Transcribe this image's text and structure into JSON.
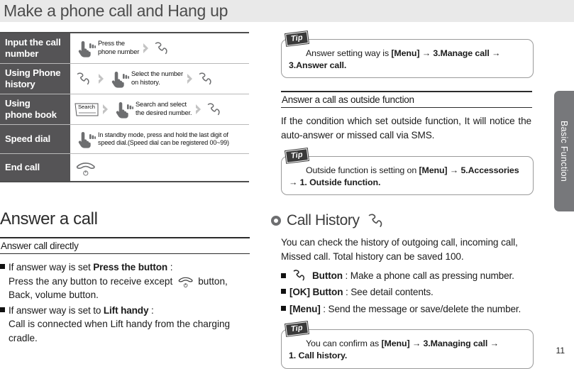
{
  "header": {
    "title": "Make a phone call and Hang up"
  },
  "side_tab": {
    "label": "Basic Function",
    "color": "#77787b"
  },
  "page_number": "11",
  "table": {
    "rows": [
      {
        "label": "Input the call number",
        "steps": [
          {
            "icon": "hand-press-icon"
          },
          {
            "text": "Press the\nphone number"
          },
          {
            "icon": "chevron-right-icon"
          },
          {
            "icon": "handset-icon"
          }
        ]
      },
      {
        "label": "Using Phone history",
        "steps": [
          {
            "icon": "handset-icon"
          },
          {
            "icon": "chevron-right-icon"
          },
          {
            "icon": "hand-press-icon"
          },
          {
            "text": "Select the number\non history."
          },
          {
            "icon": "chevron-right-icon"
          },
          {
            "icon": "handset-icon"
          }
        ]
      },
      {
        "label": "Using\nphone book",
        "steps": [
          {
            "icon": "search-key-icon",
            "icon_label": "Search"
          },
          {
            "icon": "chevron-right-icon"
          },
          {
            "icon": "hand-press-icon"
          },
          {
            "text": "Search and select\nthe desired number."
          },
          {
            "icon": "chevron-right-icon"
          },
          {
            "icon": "handset-icon"
          }
        ]
      },
      {
        "label": "Speed dial",
        "steps": [
          {
            "icon": "hand-press-icon"
          },
          {
            "text": "In standby mode, press and hold the last digit of\nspeed dial.(Speed dial can be registered 00~99)"
          }
        ]
      },
      {
        "label": "End call",
        "steps": [
          {
            "icon": "end-call-icon"
          }
        ]
      }
    ]
  },
  "left": {
    "section_title": "Answer a call",
    "subsection_title": "Answer call directly",
    "bullets": [
      {
        "lead_plain": "If answer way is set ",
        "lead_bold": "Press the button",
        "lead_tail": " :",
        "body_pre": "Press the any button to receive except ",
        "body_icon": "end-call-icon",
        "body_post": " button,",
        "body_line2": "Back, volume button."
      },
      {
        "lead_plain": "If answer way is set to ",
        "lead_bold": "Lift handy",
        "lead_tail": " :",
        "body_line1": "Call is connected when Lift handy from the charging",
        "body_line2": "cradle."
      }
    ]
  },
  "right": {
    "tip1": {
      "badge": "Tip",
      "plain1": "Answer setting way is ",
      "bold1": "[Menu]",
      "arrow1": " → ",
      "bold2": "3.Manage call",
      "arrow2": " →",
      "bold3": "3.Answer call."
    },
    "subsection_title": "Answer a call as outside function",
    "paragraph": "If the condition which set outside function, It will notice the auto-answer or missed call via SMS.",
    "tip2": {
      "badge": "Tip",
      "plain1": "Outside function is setting on ",
      "bold1": "[Menu]",
      "arrow1": " → ",
      "bold2": "5.Accessories",
      "arrow2": "→ ",
      "bold3": "1. Outside function."
    },
    "section_title": "Call History",
    "section_icon": "handset-icon",
    "paragraph2_line1": "You can check the history of outgoing call, incoming call,",
    "paragraph2_line2": "Missed call. Total history can be saved 100.",
    "bullets": [
      {
        "icon": "handset-icon",
        "bold": "Button",
        "rest": " : Make a phone call as pressing number."
      },
      {
        "bold": "[OK] Button",
        "rest": " : See detail contents."
      },
      {
        "bold": "[Menu]",
        "rest": " : Send the message or save/delete the number."
      }
    ],
    "tip3": {
      "badge": "Tip",
      "plain1": "You can confirm as ",
      "bold1": "[Menu]",
      "arrow1": " → ",
      "bold2": "3.Managing call",
      "arrow2": " →",
      "bold3": "1. Call history."
    }
  }
}
